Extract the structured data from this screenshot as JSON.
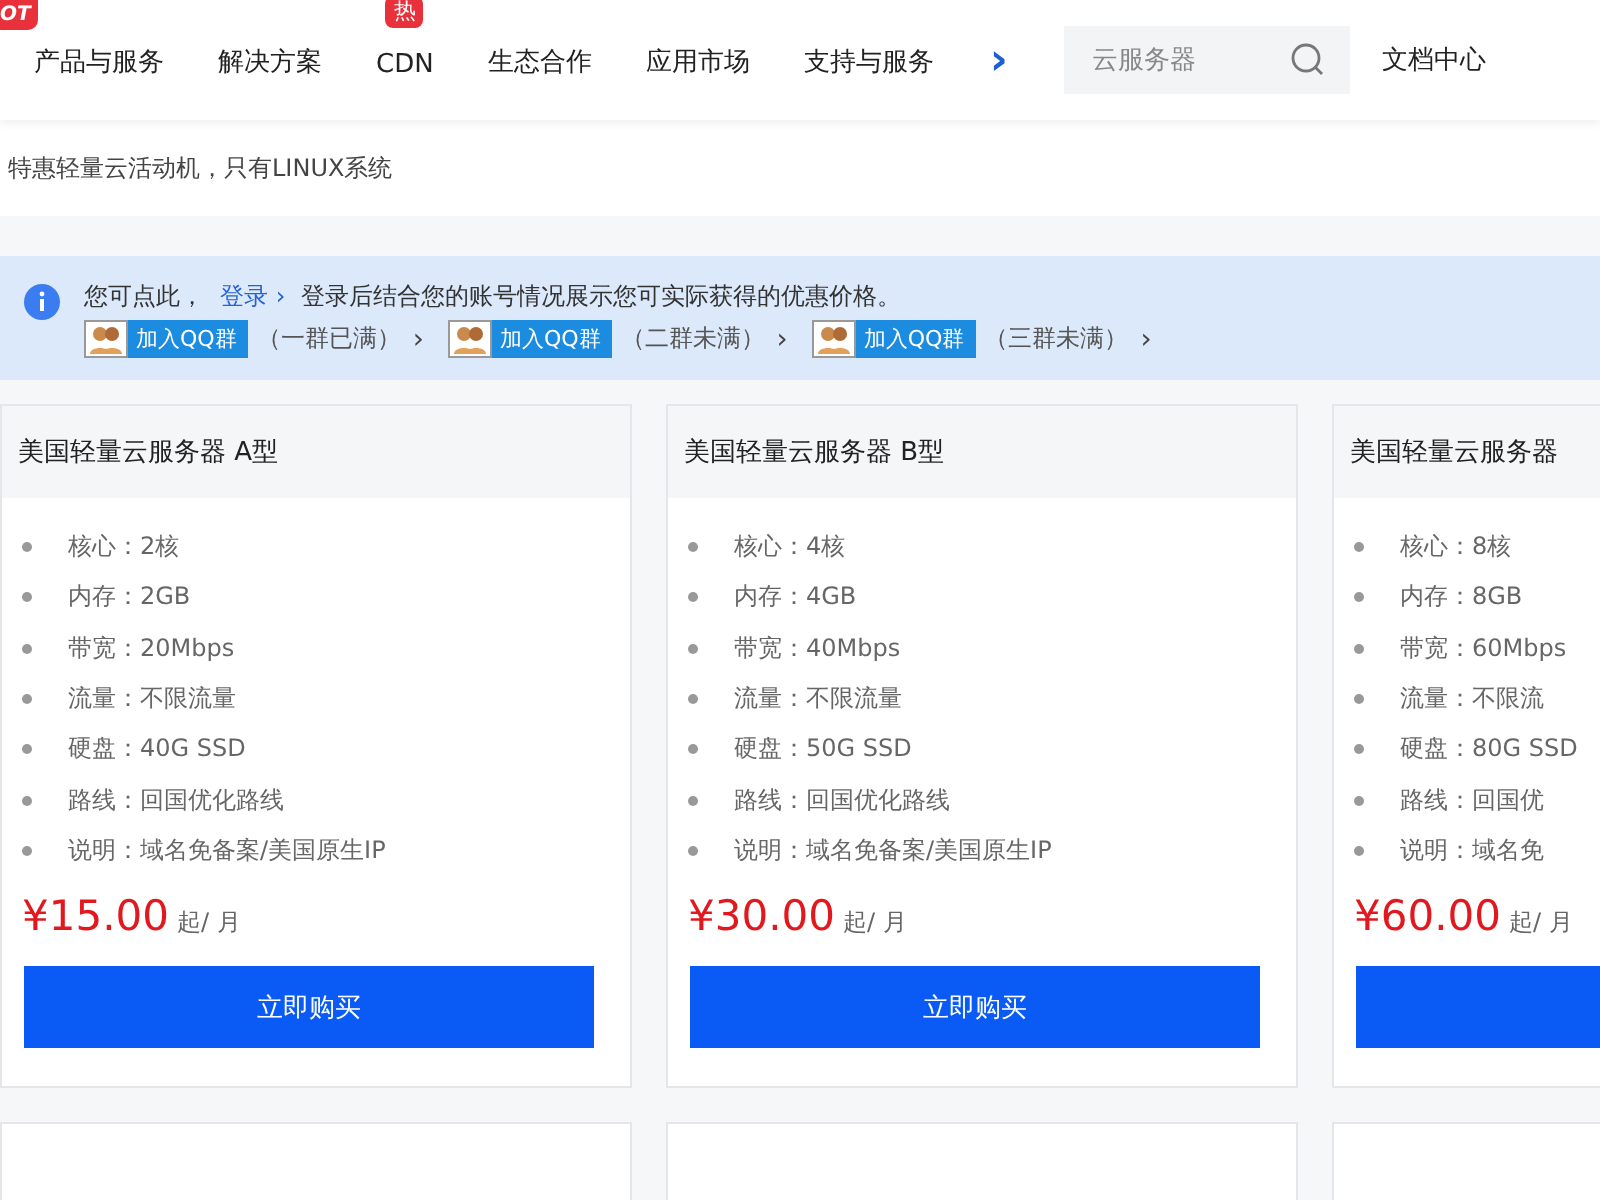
{
  "nav": {
    "hot_badge": "OT",
    "items": [
      {
        "label": "产品与服务"
      },
      {
        "label": "解决方案"
      },
      {
        "label": "CDN",
        "badge": "热"
      },
      {
        "label": "生态合作"
      },
      {
        "label": "应用市场"
      },
      {
        "label": "支持与服务"
      }
    ],
    "more": "›",
    "search": {
      "placeholder": "云服务器"
    },
    "docs": "文档中心"
  },
  "subtitle": "特惠轻量云活动机，只有LINUX系统",
  "notice": {
    "prefix": "您可点此，",
    "login_link": "登录 ›",
    "message": "登录后结合您的账号情况展示您可实际获得的优惠价格。",
    "groups": [
      {
        "button": "加入QQ群",
        "status": "（一群已满）",
        "arrow": "›"
      },
      {
        "button": "加入QQ群",
        "status": "（二群未满）",
        "arrow": "›"
      },
      {
        "button": "加入QQ群",
        "status": "（三群未满）",
        "arrow": "›"
      }
    ]
  },
  "cards": [
    {
      "title": "美国轻量云服务器 A型",
      "specs": [
        "核心：2核",
        "内存：2GB",
        "带宽：20Mbps",
        "流量：不限流量",
        "硬盘：40G SSD",
        "路线：回国优化路线",
        "说明：域名免备案/美国原生IP"
      ],
      "price": "¥15.00",
      "unit": "起/ 月",
      "buy": "立即购买"
    },
    {
      "title": "美国轻量云服务器 B型",
      "specs": [
        "核心：4核",
        "内存：4GB",
        "带宽：40Mbps",
        "流量：不限流量",
        "硬盘：50G SSD",
        "路线：回国优化路线",
        "说明：域名免备案/美国原生IP"
      ],
      "price": "¥30.00",
      "unit": "起/ 月",
      "buy": "立即购买"
    },
    {
      "title": "美国轻量云服务器",
      "specs": [
        "核心：8核",
        "内存：8GB",
        "带宽：60Mbps",
        "流量：不限流",
        "硬盘：80G SSD",
        "路线：回国优",
        "说明：域名免"
      ],
      "price": "¥60.00",
      "unit": "起/ 月"
    }
  ]
}
